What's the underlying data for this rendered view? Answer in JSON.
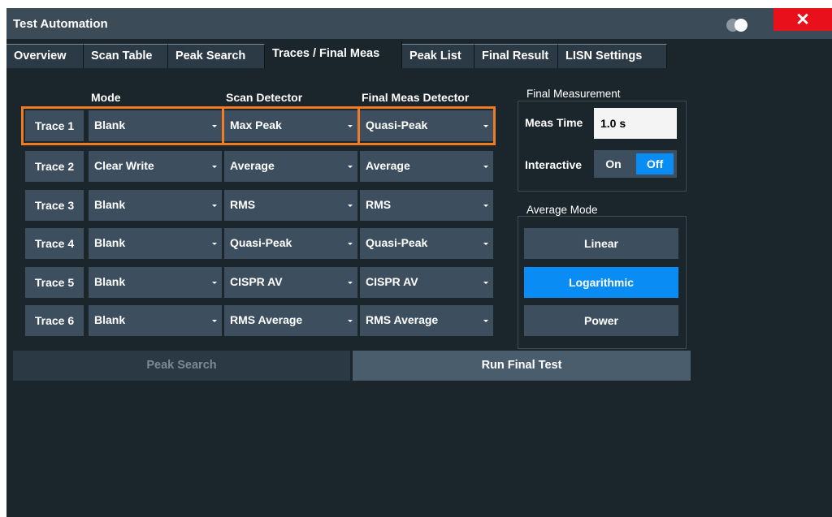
{
  "window": {
    "title": "Test Automation",
    "close_symbol": "✕"
  },
  "tabs": [
    {
      "label": "Overview",
      "active": false
    },
    {
      "label": "Scan Table",
      "active": false
    },
    {
      "label": "Peak Search",
      "active": false
    },
    {
      "label": "Traces / Final Meas",
      "active": true
    },
    {
      "label": "Peak List",
      "active": false
    },
    {
      "label": "Final Result",
      "active": false
    },
    {
      "label": "LISN Settings",
      "active": false
    }
  ],
  "columns": {
    "mode": "Mode",
    "scan_detector": "Scan Detector",
    "final_meas_detector": "Final Meas Detector"
  },
  "traces": [
    {
      "label": "Trace 1",
      "mode": "Blank",
      "scan_detector": "Max Peak",
      "final_meas_detector": "Quasi-Peak",
      "highlighted": true
    },
    {
      "label": "Trace 2",
      "mode": "Clear Write",
      "scan_detector": "Average",
      "final_meas_detector": "Average",
      "highlighted": false
    },
    {
      "label": "Trace 3",
      "mode": "Blank",
      "scan_detector": "RMS",
      "final_meas_detector": "RMS",
      "highlighted": false
    },
    {
      "label": "Trace 4",
      "mode": "Blank",
      "scan_detector": "Quasi-Peak",
      "final_meas_detector": "Quasi-Peak",
      "highlighted": false
    },
    {
      "label": "Trace 5",
      "mode": "Blank",
      "scan_detector": "CISPR AV",
      "final_meas_detector": "CISPR AV",
      "highlighted": false
    },
    {
      "label": "Trace 6",
      "mode": "Blank",
      "scan_detector": "RMS Average",
      "final_meas_detector": "RMS Average",
      "highlighted": false
    }
  ],
  "final_measurement": {
    "title": "Final Measurement",
    "meas_time_label": "Meas Time",
    "meas_time_value": "1.0 s",
    "interactive_label": "Interactive",
    "on_label": "On",
    "off_label": "Off",
    "interactive_selected": "Off"
  },
  "average_mode": {
    "title": "Average Mode",
    "options": [
      "Linear",
      "Logarithmic",
      "Power"
    ],
    "selected": "Logarithmic"
  },
  "actions": {
    "peak_search": "Peak Search",
    "run_final_test": "Run Final Test"
  },
  "colors": {
    "background": "#1b252c",
    "panel": "#3d4f5e",
    "accent_blue": "#0a8cf5",
    "highlight_orange": "#f07b23",
    "close_red": "#e8101a"
  }
}
